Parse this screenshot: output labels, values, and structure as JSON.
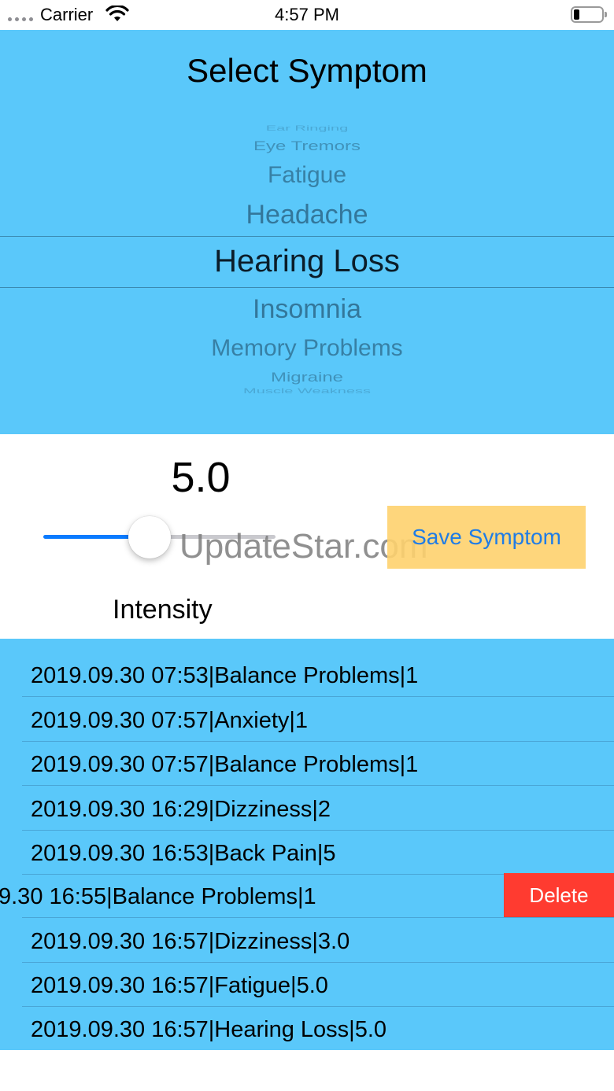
{
  "status_bar": {
    "carrier": "Carrier",
    "time": "4:57 PM"
  },
  "picker": {
    "title": "Select Symptom",
    "items": [
      "Ear Ringing",
      "Eye Tremors",
      "Fatigue",
      "Headache",
      "Hearing Loss",
      "Insomnia",
      "Memory Problems",
      "Migraine",
      "Muscle Weakness"
    ],
    "selected": "Hearing Loss",
    "background_color": "#5ac8fa"
  },
  "intensity": {
    "value": "5.0",
    "label": "Intensity",
    "slider_fraction": 0.5
  },
  "save_button": {
    "label": "Save Symptom",
    "color": "#fed16e"
  },
  "watermark": "UpdateStar.com",
  "list": {
    "rows": [
      "2019.09.30 07:53|Balance Problems|1",
      "2019.09.30 07:57|Anxiety|1",
      "2019.09.30 07:57|Balance Problems|1",
      "2019.09.30 16:29|Dizziness|2",
      "2019.09.30 16:53|Back Pain|5",
      "9.30 16:55|Balance Problems|1",
      "2019.09.30 16:57|Dizziness|3.0",
      "2019.09.30 16:57|Fatigue|5.0",
      "2019.09.30 16:57|Hearing Loss|5.0"
    ],
    "delete_label": "Delete",
    "delete_color": "#ff3b30"
  }
}
